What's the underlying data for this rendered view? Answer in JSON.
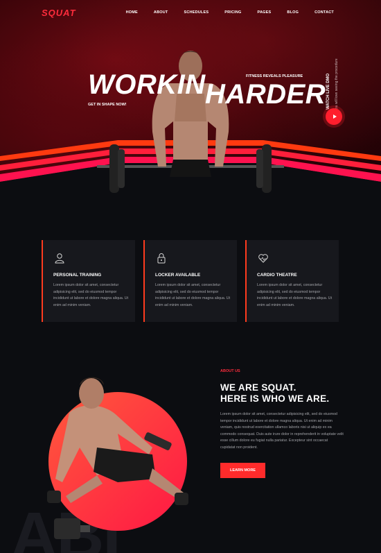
{
  "brand": {
    "logo_text": "SQUAT",
    "accent": "#ff2c3c",
    "button": "#ff2b2b"
  },
  "nav": {
    "items": [
      "HOME",
      "ABOUT",
      "SCHEDULES",
      "PRICING",
      "PAGES",
      "BLOG",
      "CONTACT"
    ]
  },
  "hero": {
    "headline_left": "WORKIN",
    "headline_right": "HARDER",
    "tagline_left": "GET IN SHAPE NOW!",
    "tagline_right": "FITNESS REVEALS PLEASURE",
    "watch_title": "WATCH LIVE DMO",
    "watch_sub": "You will love seeing the procedure",
    "play_icon": "play-icon"
  },
  "features": [
    {
      "icon": "user-icon",
      "title": "PERSONAL TRAINING",
      "desc": "Lorem ipsum dolor sit amet, consectetur adipisicing elit, sed do eiusmod tempor incididunt ut labore et dolore magna aliqua. Ut enim ad minim veniam."
    },
    {
      "icon": "lock-icon",
      "title": "LOCKER AVAILABLE",
      "desc": "Lorem ipsum dolor sit amet, consectetur adipisicing elit, sed do eiusmod tempor incididunt ut labore et dolore magna aliqua. Ut enim ad minim veniam."
    },
    {
      "icon": "heart-pulse-icon",
      "title": "CARDIO THEATRE",
      "desc": "Lorem ipsum dolor sit amet, consectetur adipisicing elit, sed do eiusmod tempor incididunt ut labore et dolore magna aliqua. Ut enim ad minim veniam."
    }
  ],
  "about": {
    "label": "ABOUT US",
    "title_line1": "WE ARE SQUAT.",
    "title_line2": "HERE IS WHO WE ARE.",
    "text": "Lorem ipsum dolor sit amet, consectetur adipisicing elit, sed do eiusmod tempor incididunt ut labore et dolore magna aliqua. Ut enim ad minim veniam, quis nostrud exercitation ullamco laboris nisi ut aliquip ex ea commodo consequat. Duis aute irure dolor in reprehenderit in voluptate velit esse cillum dolore eu fugiat nulla pariatur. Excepteur sint occaecat cupidatat non proident.",
    "button_label": "LEARN MORE",
    "watermark": "ABI"
  }
}
